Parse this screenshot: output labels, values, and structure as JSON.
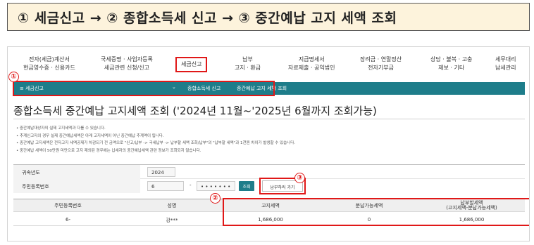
{
  "banner": {
    "title": "① 세금신고 → ② 종합소득세 신고 → ③ 중간예납 고지 세액 조회"
  },
  "topnav": {
    "items": [
      {
        "line1": "전자(세금)계산서",
        "line2": "현금영수증 · 신용카드"
      },
      {
        "line1": "국세증명 · 사업자등록",
        "line2": "세금관련 신청/신고"
      },
      {
        "line1": "세금신고",
        "line2": ""
      },
      {
        "line1": "납부",
        "line2": "고지 · 환급"
      },
      {
        "line1": "지급명세서",
        "line2": "자료제출 · 공익법인"
      },
      {
        "line1": "장려금 · 연말정산",
        "line2": "전자기부금"
      },
      {
        "line1": "상담 · 불복 · 고충",
        "line2": "제보 · 기타"
      },
      {
        "line1": "세무대리",
        "line2": "납세관리"
      }
    ]
  },
  "breadcrumb": {
    "home": "≡ 세금신고",
    "chevron": "⌄",
    "crumb2": "종합소득세 신고",
    "crumb3": "중간예납 고지 세액 조회",
    "info": "ⓘ"
  },
  "markers": {
    "m1": "①",
    "m2": "②",
    "m3": "③"
  },
  "page": {
    "title": "종합소득세 중간예납 고지세액 조회 ('2024년 11월~'2025년 6월까지 조회가능)"
  },
  "notes": [
    "• 중간예납대상자의 실제 고지세액과 다를 수 있습니다.",
    "• 추계신고자의 경우 실제 중간예납세액은 아래 고지세액이 아닌 중간예납 추계액이 됩니다.",
    "• 중간예납 고지세액은 전자고지 세액공제가 차감되기 전 금액으로 \"신고/납부 -> 국세납부 -> 납부할 세액 조회/납부\"의 \"납부할 세액\"과 1천원 차이가 발생할 수 있습니다.",
    "• 중간예납 세액이 50만원 미만으로 고지 제외된 경우에는 납세자의 중간예납세액 관련 정보가 조회되지 않습니다."
  ],
  "form": {
    "year_label": "귀속년도",
    "year_value": "2024",
    "rrn_label": "주민등록번호",
    "rrn_front": "6",
    "rrn_dash": "-",
    "rrn_back": "• • • • • • •",
    "query_button": "조회",
    "pay_button": "납부하러 가기"
  },
  "table": {
    "headers": [
      "주민등록번호",
      "성명",
      "고지세액",
      "분납가능세액",
      "납부할세액",
      "(고지세액-분납가능세액)"
    ],
    "rows": [
      [
        "6-",
        "강***",
        "1,686,000",
        "0",
        "1,686,000"
      ]
    ]
  },
  "colors": {
    "accent": "#1e7d8a",
    "highlight": "#e01818",
    "banner_bg": "#fdf3dc"
  }
}
